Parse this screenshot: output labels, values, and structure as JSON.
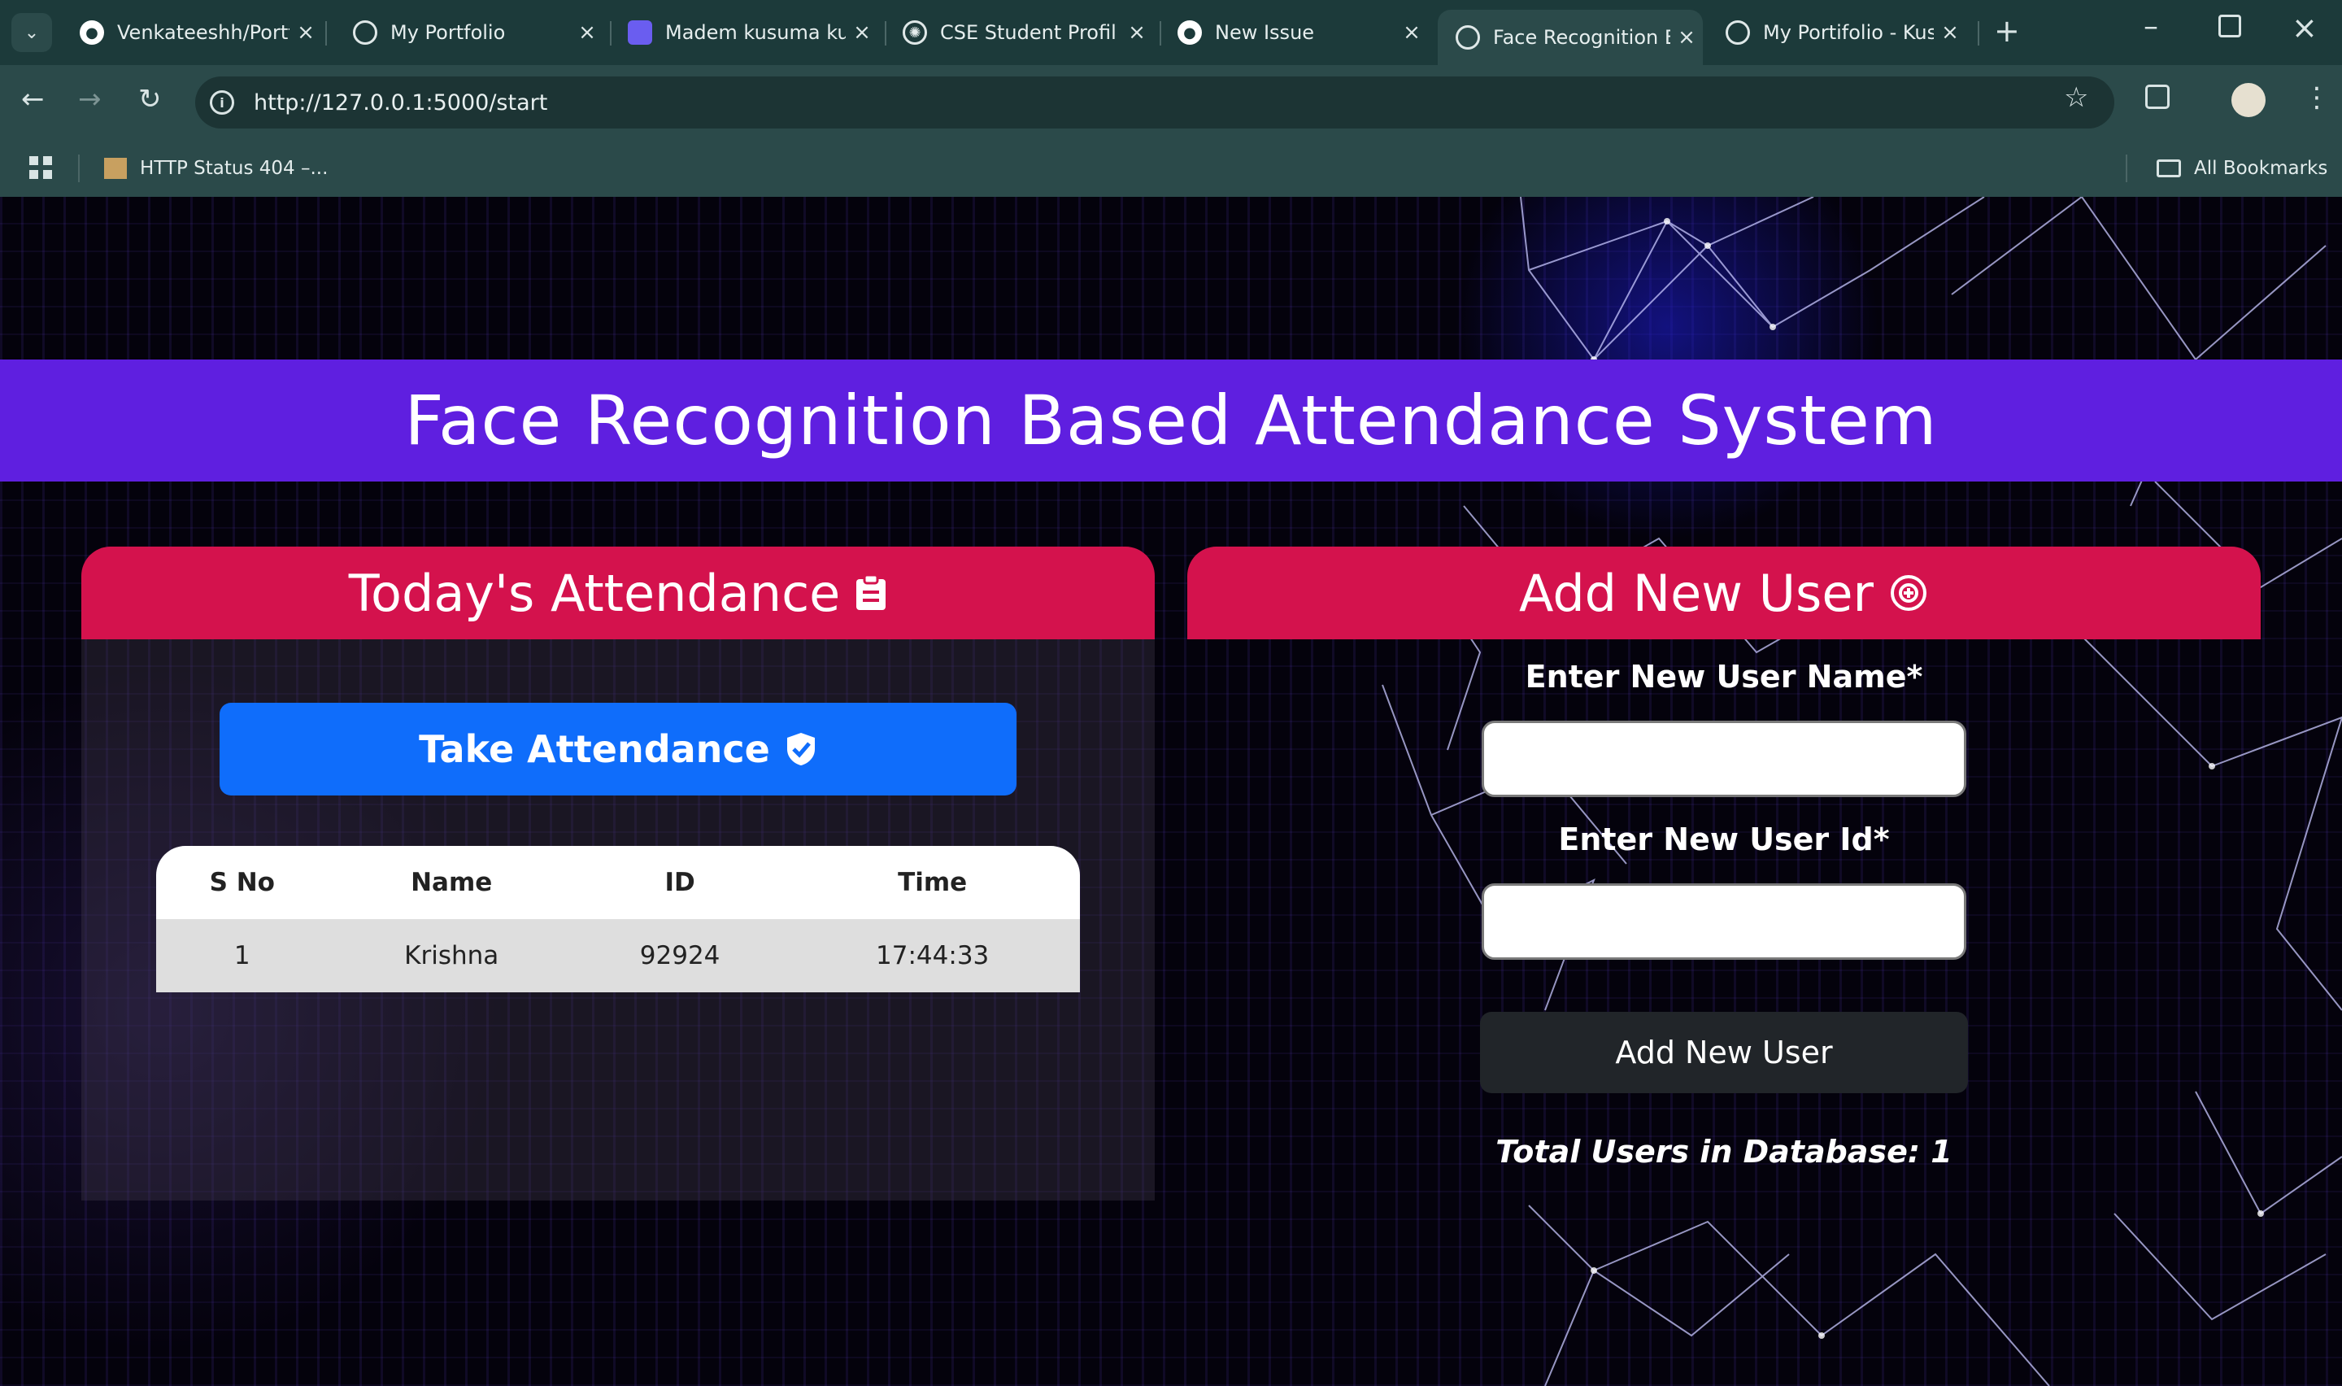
{
  "browser": {
    "tabs": [
      {
        "title": "Venkateeshh/Portf",
        "icon": "github-icon"
      },
      {
        "title": "My Portfolio",
        "icon": "globe-icon"
      },
      {
        "title": "Madem kusuma ku",
        "icon": "app-icon"
      },
      {
        "title": "CSE Student Profil",
        "icon": "chatgpt-icon"
      },
      {
        "title": "New Issue",
        "icon": "github-icon"
      },
      {
        "title": "Face Recognition B",
        "icon": "globe-icon",
        "active": true
      },
      {
        "title": "My Portifolio - Kus",
        "icon": "globe-icon"
      }
    ],
    "url": "http://127.0.0.1:5000/start",
    "bookmark": "HTTP Status 404 –...",
    "all_bookmarks": "All Bookmarks"
  },
  "page": {
    "title": "Face Recognition Based Attendance System",
    "attendance": {
      "heading": "Today's Attendance",
      "button": "Take Attendance",
      "columns": [
        "S No",
        "Name",
        "ID",
        "Time"
      ],
      "rows": [
        {
          "sno": "1",
          "name": "Krishna",
          "id": "92924",
          "time": "17:44:33"
        }
      ]
    },
    "add_user": {
      "heading": "Add New User",
      "name_label": "Enter New User Name*",
      "id_label": "Enter New User Id*",
      "name_value": "",
      "id_value": "",
      "button": "Add New User",
      "total_users": "Total Users in Database: 1"
    }
  },
  "colors": {
    "banner": "#5f1fe0",
    "panel_header": "#d4124d",
    "primary_button": "#0f6dfb",
    "dark_button": "#212529"
  }
}
